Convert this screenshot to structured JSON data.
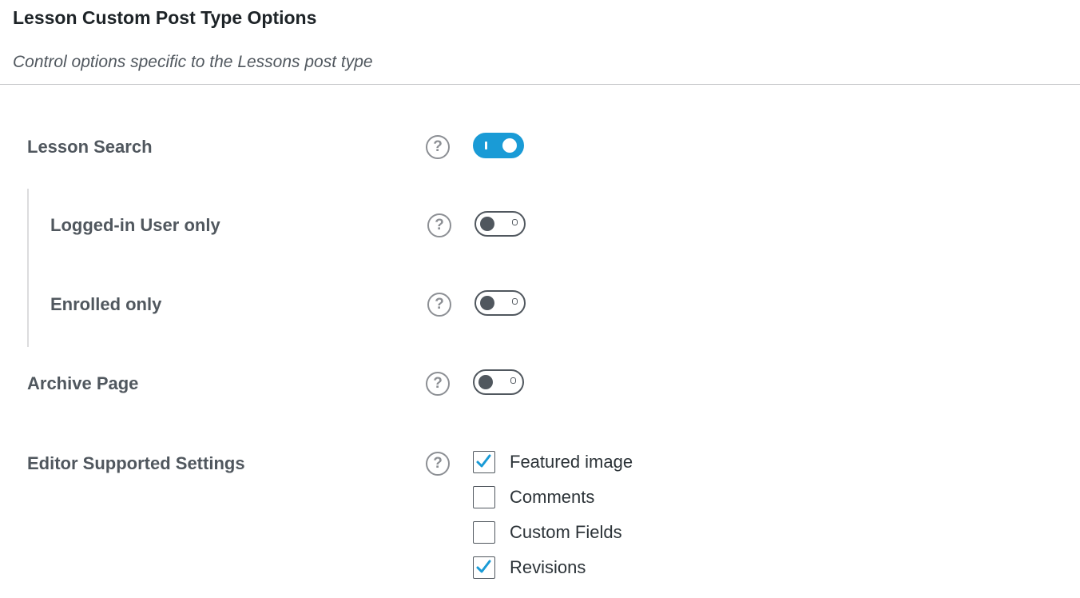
{
  "section": {
    "title": "Lesson Custom Post Type Options",
    "description": "Control options specific to the Lessons post type"
  },
  "settings": {
    "lesson_search": {
      "label": "Lesson Search",
      "help_glyph": "?",
      "enabled": true
    },
    "logged_in_only": {
      "label": "Logged-in User only",
      "help_glyph": "?",
      "enabled": false
    },
    "enrolled_only": {
      "label": "Enrolled only",
      "help_glyph": "?",
      "enabled": false
    },
    "archive_page": {
      "label": "Archive Page",
      "help_glyph": "?",
      "enabled": false
    },
    "editor_supported": {
      "label": "Editor Supported Settings",
      "help_glyph": "?",
      "options": [
        {
          "label": "Featured image",
          "checked": true
        },
        {
          "label": "Comments",
          "checked": false
        },
        {
          "label": "Custom Fields",
          "checked": false
        },
        {
          "label": "Revisions",
          "checked": true
        }
      ]
    }
  },
  "icons": {
    "help": "question-circle-icon",
    "check": "checkmark-icon"
  },
  "colors": {
    "accent": "#1a9bd6",
    "toggle_off": "#50575e",
    "label": "#50575e",
    "help_icon": "#8c8f94",
    "divider": "#c3c4c7",
    "indent_bar": "#dcdcde"
  }
}
